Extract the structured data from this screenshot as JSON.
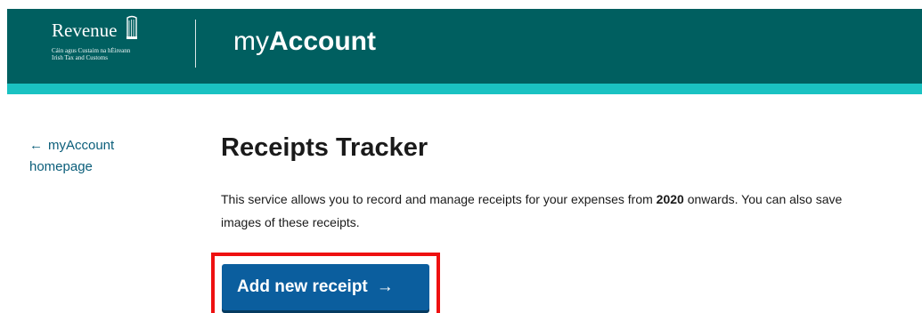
{
  "header": {
    "logo_name": "Revenue",
    "logo_sub_line1": "Cáin agus Custaim na hÉireann",
    "logo_sub_line2": "Irish Tax and Customs",
    "app_title_prefix": "my",
    "app_title_main": "Account"
  },
  "nav": {
    "back_arrow": "←",
    "back_label": "myAccount homepage"
  },
  "main": {
    "title": "Receipts Tracker",
    "intro_before": "This service allows you to record and manage receipts for your expenses from ",
    "intro_year": "2020",
    "intro_after": " onwards. You can also save images of these receipts.",
    "add_button_label": "Add new receipt",
    "add_button_arrow": "→"
  },
  "colors": {
    "header_bg": "#005f60",
    "header_stripe": "#1ac2c2",
    "link": "#0b5e7a",
    "button_bg": "#0b5e9e",
    "highlight_border": "#ee1111"
  },
  "icons": {
    "logo_emblem": "harp-icon",
    "back_arrow": "arrow-left-icon",
    "button_arrow": "arrow-right-icon"
  }
}
